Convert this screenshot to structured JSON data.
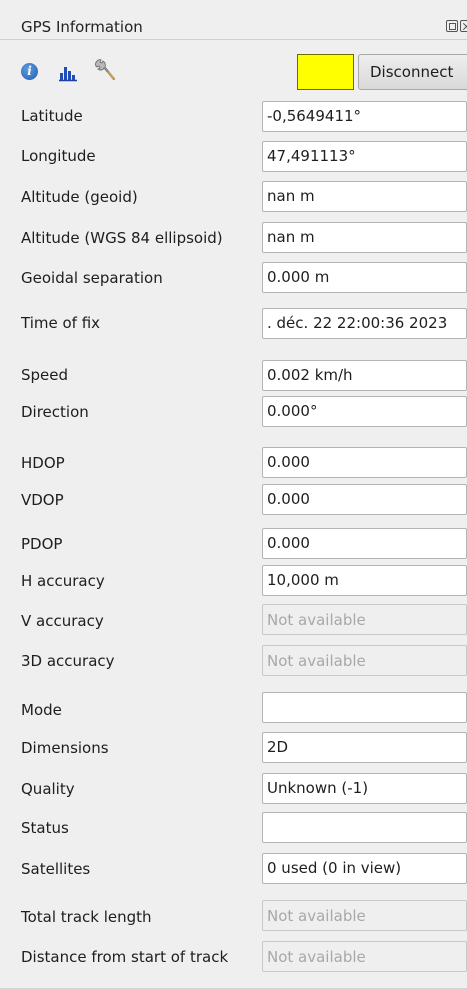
{
  "window": {
    "title": "GPS Information"
  },
  "toolbar": {
    "icons": [
      "info-icon",
      "histogram-icon",
      "wrench-icon"
    ],
    "swatch_color": "#ffff00",
    "disconnect_label": "Disconnect"
  },
  "rows": {
    "latitude": {
      "label": "Latitude",
      "value": "-0,5649411°"
    },
    "longitude": {
      "label": "Longitude",
      "value": "47,491113°"
    },
    "altitude_geoid": {
      "label": "Altitude (geoid)",
      "value": "nan m"
    },
    "altitude_wgs84": {
      "label": "Altitude (WGS 84 ellipsoid)",
      "value": "nan m"
    },
    "geoidal_separation": {
      "label": "Geoidal separation",
      "value": "0.000 m"
    },
    "time_of_fix": {
      "label": "Time of fix",
      "value": ". déc. 22 22:00:36 2023"
    },
    "speed": {
      "label": "Speed",
      "value": "0.002 km/h"
    },
    "direction": {
      "label": "Direction",
      "value": "0.000°"
    },
    "hdop": {
      "label": "HDOP",
      "value": "0.000"
    },
    "vdop": {
      "label": "VDOP",
      "value": "0.000"
    },
    "pdop": {
      "label": "PDOP",
      "value": "0.000"
    },
    "h_accuracy": {
      "label": "H accuracy",
      "value": "10,000 m"
    },
    "v_accuracy": {
      "label": "V accuracy",
      "placeholder": "Not available"
    },
    "accuracy_3d": {
      "label": "3D accuracy",
      "placeholder": "Not available"
    },
    "mode": {
      "label": "Mode",
      "value": ""
    },
    "dimensions": {
      "label": "Dimensions",
      "value": "2D"
    },
    "quality": {
      "label": "Quality",
      "value": "Unknown (-1)"
    },
    "status": {
      "label": "Status",
      "value": ""
    },
    "satellites": {
      "label": "Satellites",
      "value": "0 used (0 in view)"
    },
    "total_track_length": {
      "label": "Total track length",
      "placeholder": "Not available"
    },
    "distance_from_start": {
      "label": "Distance from start of track",
      "placeholder": "Not available"
    }
  }
}
